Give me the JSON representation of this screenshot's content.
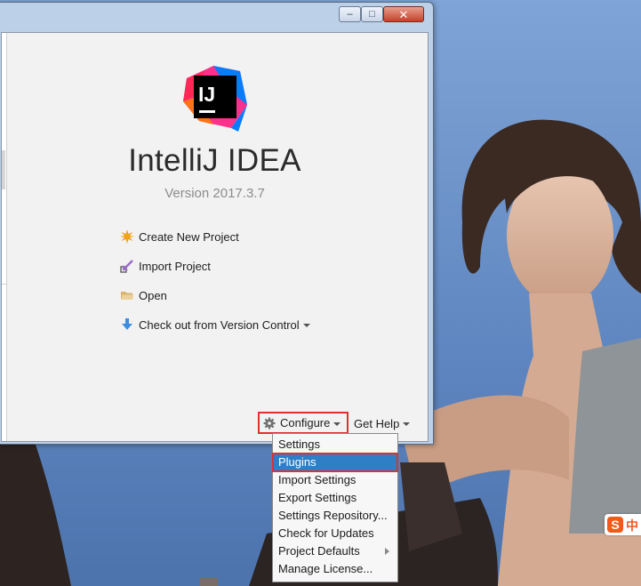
{
  "window": {
    "title": "",
    "minimize_label": "‒",
    "maximize_label": "□",
    "close_label": "✕"
  },
  "welcome": {
    "logo_text": "IJ",
    "app_name": "IntelliJ IDEA",
    "version": "Version 2017.3.7"
  },
  "actions": [
    {
      "label": "Create New Project",
      "icon": "sparkle-icon"
    },
    {
      "label": "Import Project",
      "icon": "import-arrow-icon"
    },
    {
      "label": "Open",
      "icon": "folder-icon"
    },
    {
      "label": "Check out from Version Control",
      "icon": "download-arrow-icon"
    }
  ],
  "toolbar": {
    "configure_label": "Configure",
    "get_help_label": "Get Help"
  },
  "configure_menu": {
    "items": [
      {
        "label": "Settings"
      },
      {
        "label": "Plugins",
        "selected": true
      },
      {
        "label": "Import Settings"
      },
      {
        "label": "Export Settings"
      },
      {
        "label": "Settings Repository..."
      },
      {
        "label": "Check for Updates"
      },
      {
        "label": "Project Defaults",
        "has_submenu": true
      },
      {
        "label": "Manage License..."
      }
    ]
  },
  "ime": {
    "logo": "S",
    "mode": "中"
  },
  "colors": {
    "selection": "#2f7fc6",
    "highlight_box": "#e03030",
    "ime_brand": "#f25a1a"
  }
}
